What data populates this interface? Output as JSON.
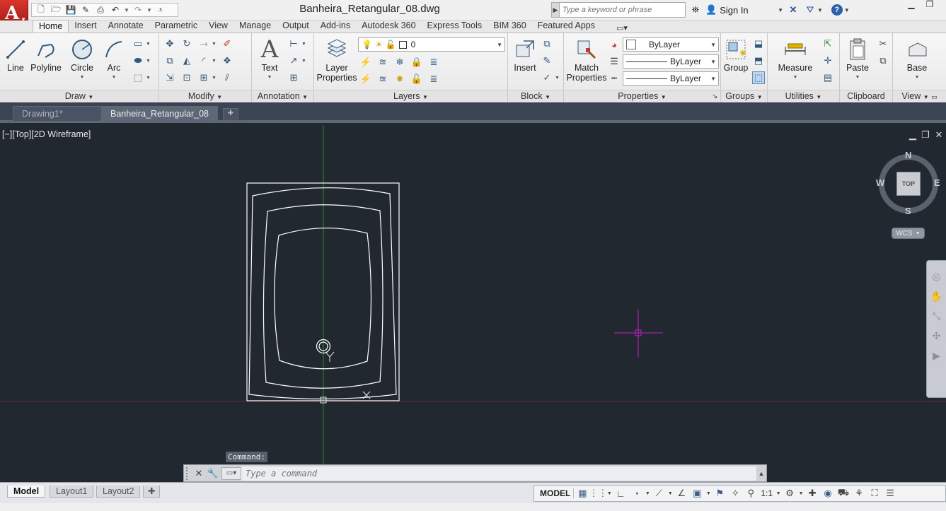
{
  "title_bar": {
    "document_title": "Banheira_Retangular_08.dwg",
    "search_placeholder": "Type a keyword or phrase",
    "sign_in": "Sign In",
    "help_label": "?"
  },
  "app_menu": {
    "logo_letter": "A"
  },
  "ribbon_tabs": [
    "Home",
    "Insert",
    "Annotate",
    "Parametric",
    "View",
    "Manage",
    "Output",
    "Add-ins",
    "Autodesk 360",
    "Express Tools",
    "BIM 360",
    "Featured Apps"
  ],
  "ribbon_active_tab": "Home",
  "ribbon": {
    "draw": {
      "title": "Draw",
      "line": "Line",
      "polyline": "Polyline",
      "circle": "Circle",
      "arc": "Arc"
    },
    "modify": {
      "title": "Modify"
    },
    "annotation": {
      "title": "Annotation",
      "text": "Text"
    },
    "layers": {
      "title": "Layers",
      "layer_properties_1": "Layer",
      "layer_properties_2": "Properties",
      "current_layer": "0"
    },
    "block": {
      "title": "Block",
      "insert": "Insert"
    },
    "properties": {
      "title": "Properties",
      "match_1": "Match",
      "match_2": "Properties",
      "color": "ByLayer",
      "linetype": "ByLayer",
      "lineweight": "ByLayer"
    },
    "groups": {
      "title": "Groups",
      "group": "Group"
    },
    "utilities": {
      "title": "Utilities",
      "measure": "Measure"
    },
    "clipboard": {
      "title": "Clipboard",
      "paste": "Paste"
    },
    "view": {
      "title": "View",
      "base": "Base"
    }
  },
  "doc_tabs": [
    {
      "label": "Drawing1*",
      "active": false
    },
    {
      "label": "Banheira_Retangular_08",
      "active": true
    }
  ],
  "viewport": {
    "label": "[−][Top][2D Wireframe]",
    "compass": {
      "n": "N",
      "s": "S",
      "e": "E",
      "w": "W",
      "cube_face": "TOP"
    },
    "wcs": "WCS"
  },
  "command": {
    "history": "Command:",
    "placeholder": "Type a command"
  },
  "layout_tabs": [
    "Model",
    "Layout1",
    "Layout2"
  ],
  "status_bar": {
    "model": "MODEL",
    "scale": "1:1"
  },
  "colors": {
    "canvas_bg": "#212830",
    "crosshair": "#c81ec8",
    "y_axis": "#2a8a2a",
    "x_axis": "#8a2a2a",
    "geometry": "#ffffff",
    "accent_red": "#c0221a"
  }
}
